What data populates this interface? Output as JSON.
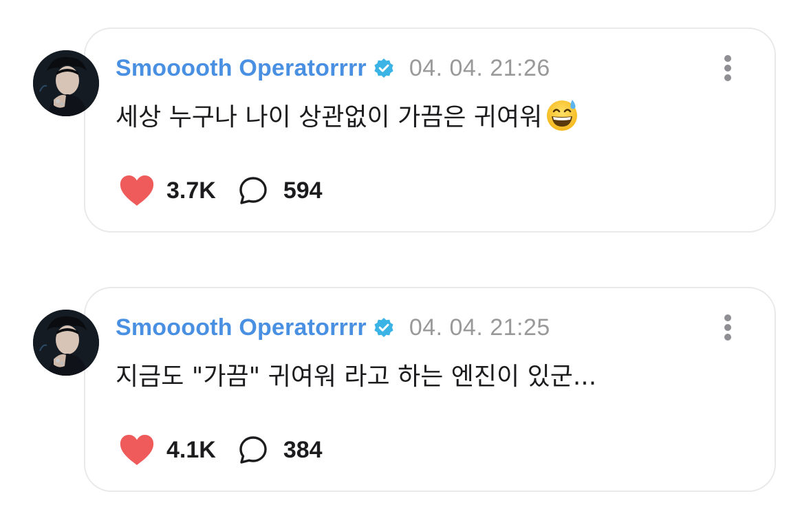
{
  "posts": [
    {
      "username": "Smooooth Operatorrrr",
      "timestamp": "04. 04. 21:26",
      "text": "세상 누구나 나이 상관없이 가끔은 귀여워",
      "emoji": "grinning-face-with-sweat",
      "likes": "3.7K",
      "comments": "594"
    },
    {
      "username": "Smooooth Operatorrrr",
      "timestamp": "04. 04. 21:25",
      "text": "지금도 \"가끔\" 귀여워 라고 하는 엔진이 있군...",
      "likes": "4.1K",
      "comments": "384"
    }
  ],
  "icons": {
    "verified": "verified-badge-icon",
    "like": "heart-icon",
    "comment": "comment-bubble-icon",
    "more": "more-vertical-icon"
  },
  "colors": {
    "username": "#4a90e2",
    "verified": "#3bb3e5",
    "heart": "#ef5a5a",
    "timestamp": "#999999",
    "text": "#1c1c1e",
    "card_border": "#e9e9ec"
  }
}
